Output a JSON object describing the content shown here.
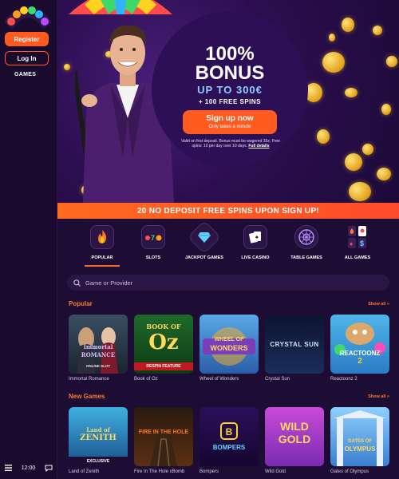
{
  "sidebar": {
    "register_label": "Register",
    "login_label": "Log In",
    "games_label": "GAMES",
    "time": "12:00"
  },
  "hero": {
    "line1": "100%",
    "line2": "BONUS",
    "line3": "UP TO 300€",
    "line4": "+ 100 FREE SPINS",
    "cta_label": "Sign up now",
    "cta_sub": "Only takes a minute",
    "terms": "Valid on first deposit. Bonus must be wagered 35x. Free spins: 10 per day over 10 days.",
    "terms_link": "Full details"
  },
  "banner": "20 NO DEPOSIT FREE SPINS UPON SIGN UP!",
  "categories": [
    {
      "label": "POPULAR",
      "icon": "fire-icon",
      "active": true
    },
    {
      "label": "SLOTS",
      "icon": "slots-icon",
      "active": false
    },
    {
      "label": "JACKPOT GAMES",
      "icon": "diamond-icon",
      "active": false
    },
    {
      "label": "LIVE CASINO",
      "icon": "cards-icon",
      "active": false
    },
    {
      "label": "TABLE GAMES",
      "icon": "roulette-icon",
      "active": false
    },
    {
      "label": "ALL GAMES",
      "icon": "grid-icon",
      "active": false
    }
  ],
  "search": {
    "placeholder": "Game or Provider"
  },
  "popular": {
    "title": "Popular",
    "show_all": "Show all »",
    "games": [
      {
        "name": "Immortal Romance"
      },
      {
        "name": "Book of Oz"
      },
      {
        "name": "Wheel of Wonders"
      },
      {
        "name": "Crystal Sun"
      },
      {
        "name": "Reactoonz 2"
      }
    ]
  },
  "new_games": {
    "title": "New Games",
    "show_all": "Show all »",
    "games": [
      {
        "name": "Land of Zenith"
      },
      {
        "name": "Fire In The Hole xBomb"
      },
      {
        "name": "Bompers"
      },
      {
        "name": "Wild Gold"
      },
      {
        "name": "Gates of Olympus"
      }
    ]
  },
  "tile_art": {
    "immortal_1": "Immortal",
    "immortal_2": "ROMANCE",
    "immortal_3": "ONLINE SLOT",
    "oz_1": "BOOK OF",
    "oz_2": "Oz",
    "oz_3": "RESPIN FEATURE",
    "wonders_1": "WHEEL OF",
    "wonders_2": "WONDERS",
    "crystal": "CRYSTAL SUN",
    "reactoonz_1": "REACTOONZ",
    "reactoonz_2": "2",
    "zenith_1": "Land of",
    "zenith_2": "ZENITH",
    "zenith_badge": "EXCLUSIVE",
    "fire": "FIRE IN THE HOLE",
    "bompers": "BOMPERS",
    "wildgold_1": "WILD",
    "wildgold_2": "GOLD",
    "olympus_1": "GATES OF",
    "olympus_2": "OLYMPUS"
  }
}
